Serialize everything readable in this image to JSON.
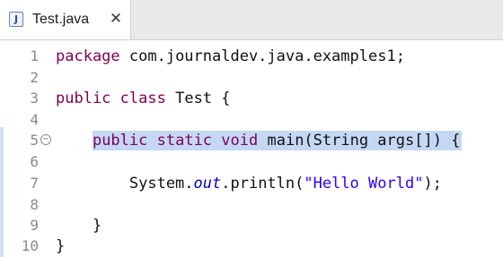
{
  "tab": {
    "icon_letter": "J",
    "title": "Test.java",
    "close_glyph": "✕"
  },
  "editor": {
    "lines": [
      {
        "num": "1",
        "parts": [
          {
            "t": "package",
            "c": "kw"
          },
          {
            "t": " com.journaldev.java.examples1;",
            "c": ""
          }
        ]
      },
      {
        "num": "2",
        "parts": []
      },
      {
        "num": "3",
        "parts": [
          {
            "t": "public",
            "c": "kw"
          },
          {
            "t": " ",
            "c": ""
          },
          {
            "t": "class",
            "c": "kw"
          },
          {
            "t": " Test {",
            "c": ""
          }
        ]
      },
      {
        "num": "4",
        "parts": []
      },
      {
        "num": "5",
        "fold": "−",
        "parts": [
          {
            "t": "    ",
            "c": ""
          },
          {
            "t": "public",
            "c": "kw"
          },
          {
            "t": " ",
            "c": ""
          },
          {
            "t": "static",
            "c": "kw"
          },
          {
            "t": " ",
            "c": ""
          },
          {
            "t": "void",
            "c": "kw"
          },
          {
            "t": " main(String args[]) {",
            "c": ""
          }
        ]
      },
      {
        "num": "6",
        "parts": []
      },
      {
        "num": "7",
        "parts": [
          {
            "t": "        System.",
            "c": ""
          },
          {
            "t": "out",
            "c": "it"
          },
          {
            "t": ".println(",
            "c": ""
          },
          {
            "t": "\"Hello World\"",
            "c": "str"
          },
          {
            "t": ");",
            "c": ""
          }
        ]
      },
      {
        "num": "8",
        "parts": []
      },
      {
        "num": "9",
        "parts": [
          {
            "t": "    }",
            "c": ""
          }
        ]
      },
      {
        "num": "10",
        "parts": [
          {
            "t": "}",
            "c": ""
          }
        ]
      }
    ]
  },
  "colors": {
    "keyword": "#7f0055",
    "string": "#2a00ff",
    "field": "#0000c0",
    "highlight": "#c4d8f4"
  }
}
